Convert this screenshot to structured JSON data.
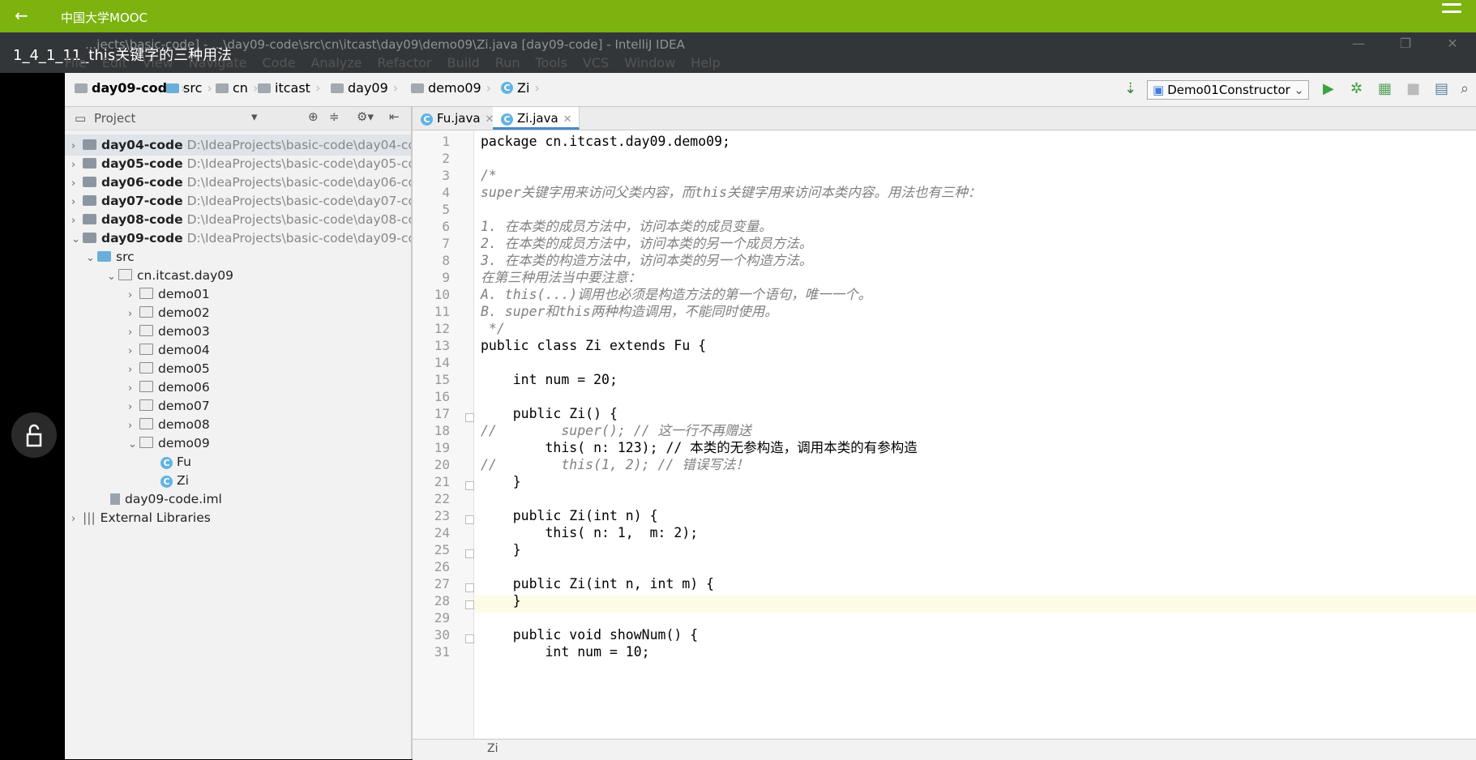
{
  "app": {
    "back_icon": "arrow-left-icon",
    "title": "中国大学MOOC",
    "menu_icon": "hamburger-menu-icon"
  },
  "overlay": {
    "video_title": "1_4_1_11_this关键字的三种用法",
    "window_title": "...jects\\basic-code] - ...\\day09-code\\src\\cn\\itcast\\day09\\demo09\\Zi.java [day09-code] - IntelliJ IDEA"
  },
  "ide_menu": [
    "File",
    "Edit",
    "View",
    "Navigate",
    "Code",
    "Analyze",
    "Refactor",
    "Build",
    "Run",
    "Tools",
    "VCS",
    "Window",
    "Help"
  ],
  "breadcrumb": [
    "day09-code",
    "src",
    "cn",
    "itcast",
    "day09",
    "demo09",
    "Zi"
  ],
  "run_config": "Demo01Constructor",
  "project_panel": {
    "title": "Project",
    "modules": [
      {
        "name": "day04-code",
        "path": "D:\\IdeaProjects\\basic-code\\day04-co"
      },
      {
        "name": "day05-code",
        "path": "D:\\IdeaProjects\\basic-code\\day05-co"
      },
      {
        "name": "day06-code",
        "path": "D:\\IdeaProjects\\basic-code\\day06-co"
      },
      {
        "name": "day07-code",
        "path": "D:\\IdeaProjects\\basic-code\\day07-co"
      },
      {
        "name": "day08-code",
        "path": "D:\\IdeaProjects\\basic-code\\day08-co"
      },
      {
        "name": "day09-code",
        "path": "D:\\IdeaProjects\\basic-code\\day09-co"
      }
    ],
    "src": "src",
    "package": "cn.itcast.day09",
    "demos": [
      "demo01",
      "demo02",
      "demo03",
      "demo04",
      "demo05",
      "demo06",
      "demo07",
      "demo08",
      "demo09"
    ],
    "classes": [
      "Fu",
      "Zi"
    ],
    "iml": "day09-code.iml",
    "libraries": "External Libraries"
  },
  "tabs": [
    {
      "label": "Fu.java"
    },
    {
      "label": "Zi.java"
    }
  ],
  "editor": {
    "line_numbers": [
      "1",
      "2",
      "3",
      "4",
      "5",
      "6",
      "7",
      "8",
      "9",
      "10",
      "11",
      "12",
      "13",
      "14",
      "15",
      "16",
      "17",
      "18",
      "19",
      "20",
      "21",
      "22",
      "23",
      "24",
      "25",
      "26",
      "27",
      "28",
      "29",
      "30",
      "31"
    ],
    "lines": [
      "package cn.itcast.day09.demo09;",
      "",
      "/*",
      "super关键字用来访问父类内容，而this关键字用来访问本类内容。用法也有三种：",
      "",
      "1. 在本类的成员方法中，访问本类的成员变量。",
      "2. 在本类的成员方法中，访问本类的另一个成员方法。",
      "3. 在本类的构造方法中，访问本类的另一个构造方法。",
      "在第三种用法当中要注意：",
      "A. this(...)调用也必须是构造方法的第一个语句，唯一一个。",
      "B. super和this两种构造调用，不能同时使用。",
      " */",
      "public class Zi extends Fu {",
      "",
      "    int num = 20;",
      "",
      "    public Zi() {",
      "//        super(); // 这一行不再赠送",
      "        this( n: 123); // 本类的无参构造，调用本类的有参构造",
      "//        this(1, 2); // 错误写法！",
      "    }",
      "",
      "    public Zi(int n) {",
      "        this( n: 1,  m: 2);",
      "    }",
      "",
      "    public Zi(int n, int m) {",
      "    }",
      "",
      "    public void showNum() {",
      "        int num = 10;"
    ]
  },
  "status_bar": "Zi"
}
